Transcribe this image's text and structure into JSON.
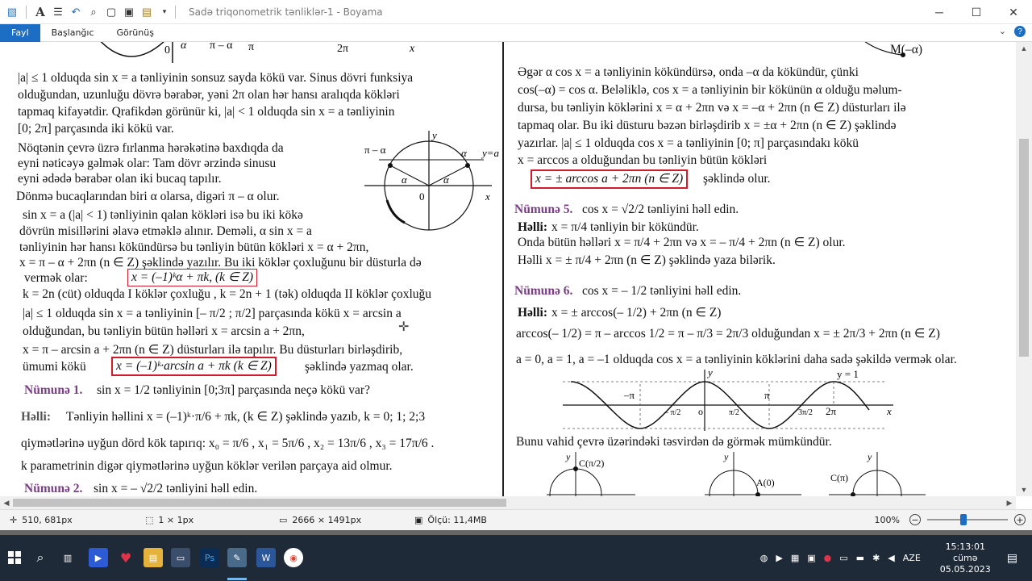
{
  "window": {
    "title": "Sadə triqonometrik tənliklər-1 - Boyama",
    "minimize": "─",
    "maximize": "☐",
    "close": "✕"
  },
  "quick_access": {
    "icons": [
      "paint-app-icon",
      "save-icon",
      "bold-a-icon",
      "list-icon",
      "undo-icon",
      "zoom-icon",
      "new-icon",
      "copy-icon",
      "paste-icon",
      "customize-icon"
    ]
  },
  "ribbon": {
    "tabs": [
      {
        "label": "Fayl",
        "active": true
      },
      {
        "label": "Başlanğıc",
        "active": false
      },
      {
        "label": "Görünüş",
        "active": false
      }
    ],
    "collapse": "⌄",
    "help": "?"
  },
  "left_page": {
    "graph_labels": {
      "zero": "0",
      "alpha": "α",
      "pi_minus_alpha": "π – α",
      "pi": "π",
      "two_pi": "2π",
      "x": "x"
    },
    "p1": [
      "|a| ≤ 1 olduqda sin x = a tənliyinin sonsuz sayda kökü var. Sinus dövri funksiya",
      "olduğundan, uzunluğu dövrə bərabər, yəni 2π olan hər hansı aralıqda kökləri",
      "tapmaq kifayətdir. Qrafikdən görünür ki, |a| < 1 olduqda sin x = a tənliyinin",
      "[0; 2π] parçasında iki kökü var."
    ],
    "p2": [
      "Nöqtənin çevrə üzrə fırlanma hərəkətinə baxdıqda da",
      "eyni nəticəyə gəlmək olar: Tam dövr ərzində sinusu",
      "eyni ədədə bərabər olan iki bucaq tapılır."
    ],
    "p3": "Dönmə bucaqlarından biri α olarsa, digəri π – α olur.",
    "p4": [
      "sin x = a (|a| < 1) tənliyinin qalan  kökləri   isə bu iki kökə",
      "dövrün misillərini əlavə etməklə alınır. Deməli, α    sin x = a",
      "tənliyinin   hər hansı kökündürsə bu tənliyin   bütün  kökləri  x = α + 2πn,",
      "x = π – α + 2πn  (n ∈ Z)  şəklində yazılır. Bu iki   köklər çoxluğunu  bir düsturla  də"
    ],
    "p5_prefix": "vermək olar:",
    "box1": "x = (–1)ᵏα + πk, (k ∈ Z)",
    "p6": "k = 2n (cüt) olduqda I  köklər çoxluğu , k = 2n + 1 (tək) olduqda II  köklər çoxluğu",
    "p7": "|a| ≤ 1 olduqda sin x = a  tənliyinin [– π/2 ; π/2] parçasında kökü x = arcsin a",
    "p8": "olduğundan, bu tənliyin bütün həlləri   x = arcsin a + 2πn,",
    "p9": "x = π – arcsin a + 2πn (n ∈ Z) düsturları ilə tapılır. Bu düsturları birləşdirib,",
    "p10_prefix": "ümumi   kökü",
    "box2": "x = (–1)ᵏ·arcsin a + πk (k ∈ Z)",
    "p10_suffix": "şəklində yazmaq olar.",
    "ex1_label": "Nümunə 1.",
    "ex1_text": "sin x =  1/2   tənliyinin [0;3π] parçasında neçə kökü var?",
    "sol_label": "Həlli:",
    "sol1_text": "Tənliyin həllini   x = (–1)ᵏ·π/6 + πk, (k ∈ Z) şəklində yazıb, k = 0; 1; 2;3",
    "sol2_text": "qiymətlərinə uyğun dörd kök tapırıq:  x₀ = π/6 , x₁ = 5π/6 ,  x₂ = 13π/6 ,  x₃ = 17π/6 .",
    "sol3_text": "k parametrinin digər qiymətlərinə uyğun köklər verilən parçaya aid olmur.",
    "ex2_label": "Nümunə 2.",
    "ex2_text": "sin x = – √2/2   tənliyini həll edin.",
    "circle_labels": {
      "y": "y",
      "x": "x",
      "zero": "0",
      "alpha": "α",
      "pi_minus_alpha": "π – α",
      "y_eq_a": "y=a"
    }
  },
  "right_page": {
    "top_label": "M(–α)",
    "p1": [
      "Əgər α    cos x = a tənliyinin kökündürsə, onda –α  da kökündür, çünki",
      "cos(–α) = cos α. Beləliklə, cos x = a tənliyinin bir kökünün α  olduğu məlum-",
      "dursa, bu tənliyin  köklərini  x = α + 2πn və x = –α + 2πn (n ∈ Z) düsturları ilə",
      "tapmaq olar. Bu iki düsturu bəzən birləşdirib   x = ±α + 2πn (n ∈ Z) şəklində",
      "yazırlar. |a| ≤ 1 olduqda cos x = a tənliyinin [0; π] parçasındakı kökü",
      "x = arccos a olduğundan bu tənliyin bütün  kökləri"
    ],
    "box3": "x = ± arccos a + 2πn (n ∈ Z)",
    "box3_suffix": "şəklində olur.",
    "ex5_label": "Nümunə 5.",
    "ex5_text": "cos x = √2/2  tənliyini həll edin.",
    "ex5_sol_label": "Həlli:",
    "ex5_sol1": "x = π/4  tənliyin bir kökündür.",
    "ex5_sol2": "Onda bütün həlləri    x = π/4 + 2πn və x = – π/4 + 2πn (n ∈ Z) olur.",
    "ex5_sol3": "Həlli x = ± π/4 + 2πn (n ∈ Z) şəklində yaza bilərik.",
    "ex6_label": "Nümunə 6.",
    "ex6_text": "cos x = – 1/2   tənliyini həll edin.",
    "ex6_sol_label": "Həlli:",
    "ex6_sol1": "x = ± arccos(– 1/2) + 2πn (n ∈ Z)",
    "ex6_sol2": "arccos(– 1/2) = π – arccos 1/2 = π – π/3 = 2π/3   olduğundan x = ± 2π/3 + 2πn (n ∈ Z)",
    "p_simple": "a = 0, a = 1, a = –1 olduqda cos x = a tənliyinin  köklərini daha sadə şəkildə vermək olar.",
    "cos_graph": {
      "y": "y",
      "x": "x",
      "o": "o",
      "y_eq_1": "y = 1",
      "minus_pi": "–π",
      "pi": "π",
      "two_pi": "2π",
      "minus_pi_half": "– π/2",
      "pi_half": "π/2",
      "three_pi_half": "3π/2"
    },
    "p_circle": "Bunu vahid çevrə üzərindəki təsvirdən də görmək mümkündür.",
    "circles": [
      {
        "y": "y",
        "point": "C(π/2)"
      },
      {
        "y": "y",
        "point": "A(0)"
      },
      {
        "y": "y",
        "point": "C(π)"
      }
    ]
  },
  "status": {
    "cursor_pos": "510, 681px",
    "selection": "1 × 1px",
    "image_size": "2666 × 1491px",
    "file_size": "Ölçü: 11,4MB",
    "zoom": "100%",
    "zoom_level": 0.45
  },
  "taskbar": {
    "language": "AZE",
    "time": "15:13:01",
    "day": "cümə",
    "date": "05.05.2023"
  }
}
